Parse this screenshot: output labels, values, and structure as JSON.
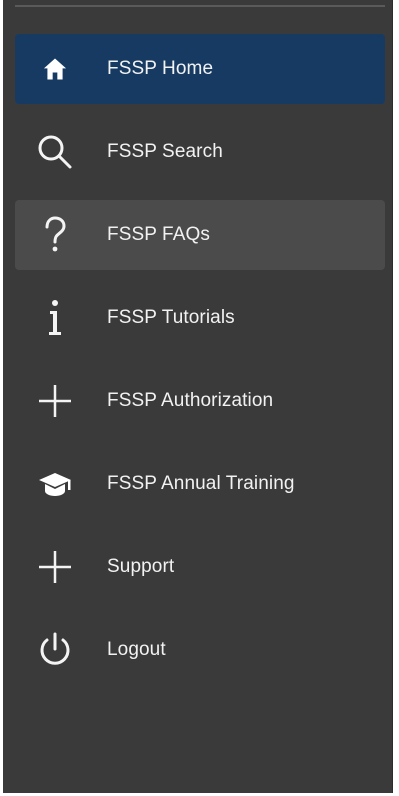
{
  "sidebar": {
    "items": [
      {
        "label": "FSSP Home",
        "icon": "home-icon",
        "state": "active"
      },
      {
        "label": "FSSP Search",
        "icon": "search-icon",
        "state": "normal"
      },
      {
        "label": "FSSP FAQs",
        "icon": "question-icon",
        "state": "hover"
      },
      {
        "label": "FSSP Tutorials",
        "icon": "info-icon",
        "state": "normal"
      },
      {
        "label": "FSSP Authorization",
        "icon": "plus-icon",
        "state": "normal"
      },
      {
        "label": "FSSP Annual Training",
        "icon": "graduation-cap-icon",
        "state": "normal"
      },
      {
        "label": "Support",
        "icon": "plus-icon",
        "state": "normal"
      },
      {
        "label": "Logout",
        "icon": "power-icon",
        "state": "normal"
      }
    ]
  },
  "colors": {
    "background": "#3a3a3a",
    "active": "#173a63",
    "hover": "#4b4b4b",
    "text": "#f2f2f2"
  }
}
